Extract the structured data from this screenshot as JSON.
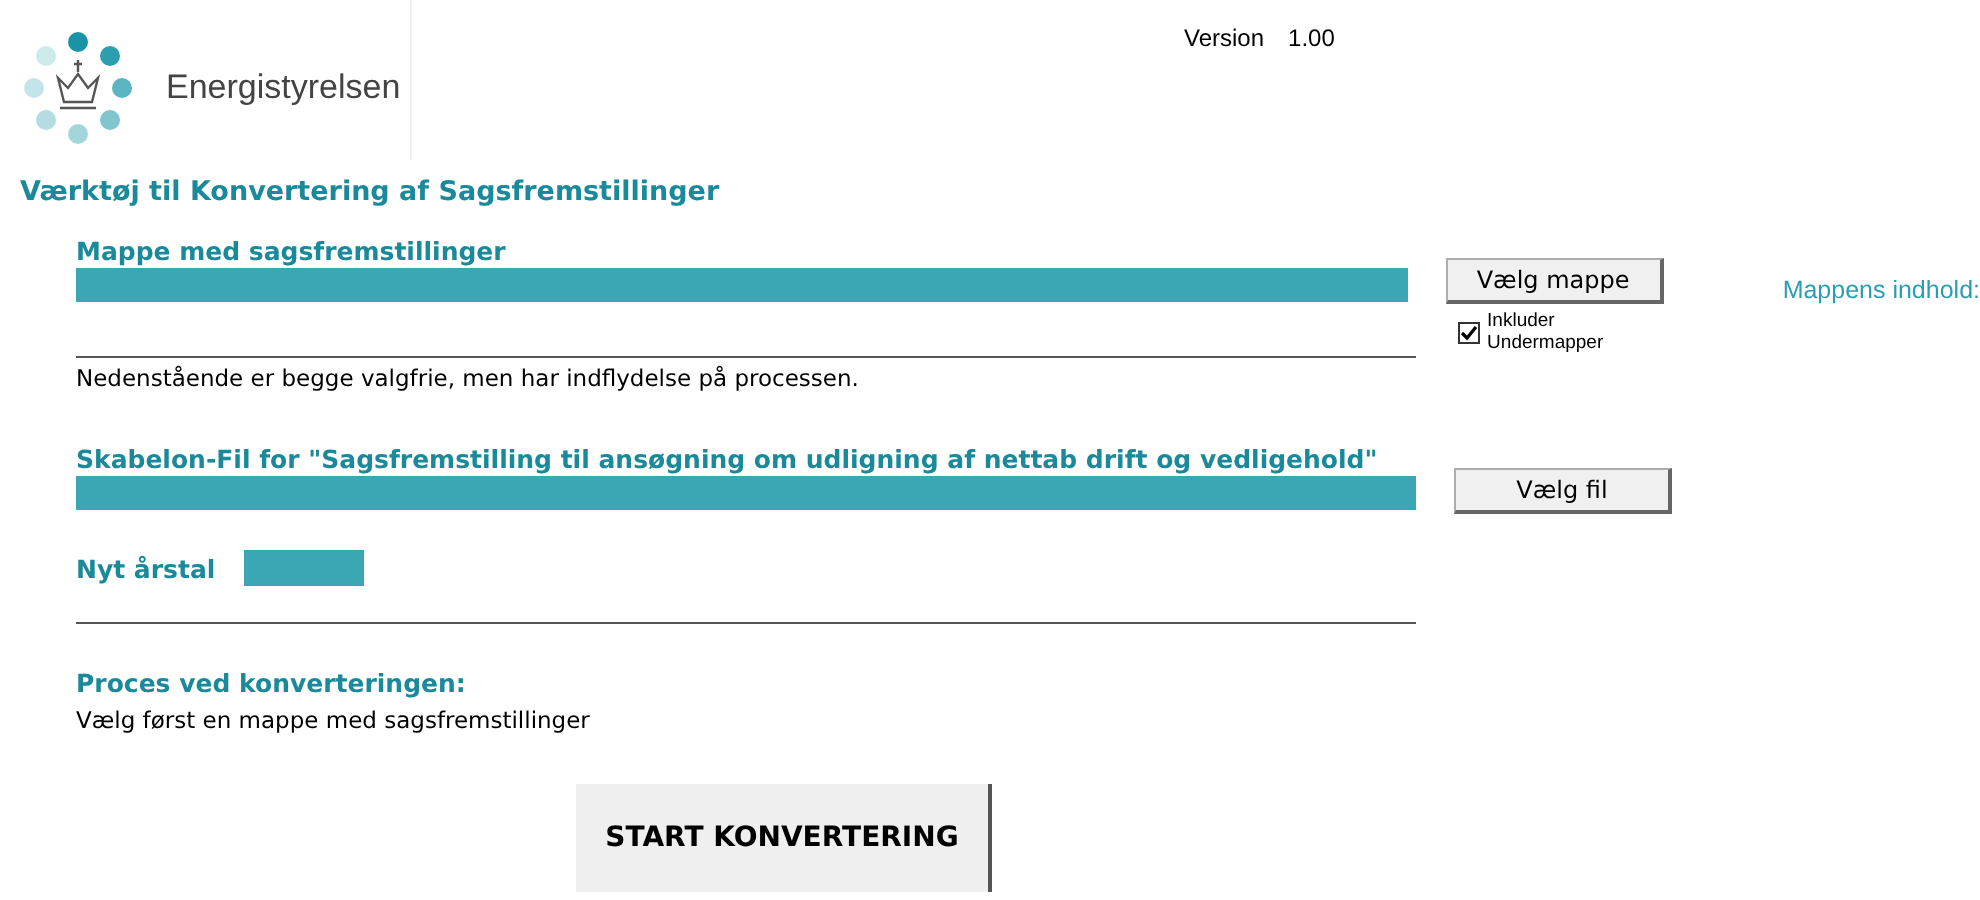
{
  "header": {
    "logo_text": "Energistyrelsen",
    "version_label": "Version",
    "version_value": "1.00"
  },
  "title": "Værktøj til Konvertering af Sagsfremstillinger",
  "folder": {
    "label": "Mappe med sagsfremstillinger",
    "button": "Vælg mappe",
    "include_subfolders": {
      "label": "Inkluder Undermapper",
      "checked": true
    },
    "contents_label": "Mappens indhold:"
  },
  "note": "Nedenstående er begge valgfrie, men har indflydelse på processen.",
  "template": {
    "label": "Skabelon-Fil for \"Sagsfremstilling til ansøgning om udligning af nettab drift og vedligehold\"",
    "button": "Vælg fil"
  },
  "year": {
    "label": "Nyt årstal"
  },
  "process": {
    "label": "Proces ved konverteringen:",
    "message": "Vælg først en mappe med sagsfremstillinger"
  },
  "start_button": "START KONVERTERING"
}
